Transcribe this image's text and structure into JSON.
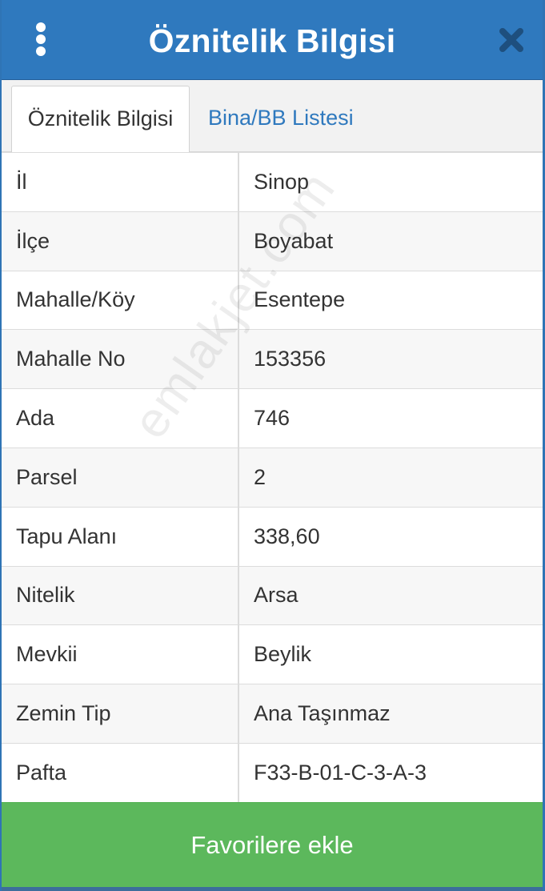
{
  "header": {
    "title": "Öznitelik Bilgisi"
  },
  "tabs": [
    {
      "label": "Öznitelik Bilgisi",
      "active": true
    },
    {
      "label": "Bina/BB Listesi",
      "active": false
    }
  ],
  "attributes": [
    {
      "label": "İl",
      "value": "Sinop"
    },
    {
      "label": "İlçe",
      "value": "Boyabat"
    },
    {
      "label": "Mahalle/Köy",
      "value": "Esentepe"
    },
    {
      "label": "Mahalle No",
      "value": "153356"
    },
    {
      "label": "Ada",
      "value": "746"
    },
    {
      "label": "Parsel",
      "value": "2"
    },
    {
      "label": "Tapu Alanı",
      "value": "338,60"
    },
    {
      "label": "Nitelik",
      "value": "Arsa"
    },
    {
      "label": "Mevkii",
      "value": "Beylik"
    },
    {
      "label": "Zemin Tip",
      "value": "Ana Taşınmaz"
    },
    {
      "label": "Pafta",
      "value": "F33-B-01-C-3-A-3"
    }
  ],
  "watermark": "emlakjet.com",
  "footer": {
    "favorite_label": "Favorilere ekle"
  },
  "colors": {
    "header": "#2f79be",
    "tab_link": "#2f79be",
    "button": "#5cb85c"
  },
  "icons": {
    "menu": "kebab-menu-icon",
    "close": "close-icon"
  }
}
